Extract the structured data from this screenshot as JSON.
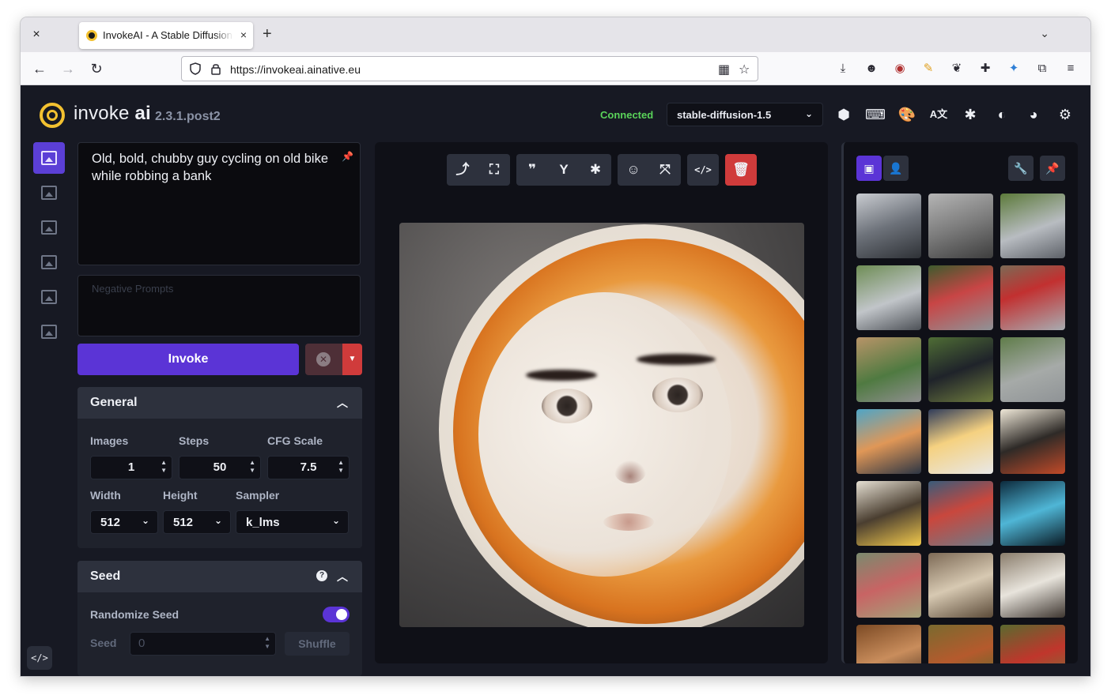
{
  "browser": {
    "tab_title": "InvokeAI - A Stable Diffusion Toolkit",
    "tab_close": "×",
    "new_tab": "+",
    "tab_list": "⌄",
    "window_close": "×",
    "url": "https://invokeai.ainative.eu"
  },
  "app": {
    "brand_light": "invoke",
    "brand_bold": "ai",
    "version": "2.3.1.post2",
    "status": "Connected",
    "model": "stable-diffusion-1.5",
    "status_color": "#5ad35a",
    "accent": "#5b34d6"
  },
  "prompt": {
    "text": "Old, bold, chubby guy cycling on old bike while robbing a bank",
    "negative_placeholder": "Negative Prompts"
  },
  "actions": {
    "invoke": "Invoke"
  },
  "general": {
    "title": "General",
    "images_label": "Images",
    "images": "1",
    "steps_label": "Steps",
    "steps": "50",
    "cfg_label": "CFG Scale",
    "cfg": "7.5",
    "width_label": "Width",
    "width": "512",
    "height_label": "Height",
    "height": "512",
    "sampler_label": "Sampler",
    "sampler": "k_lms"
  },
  "seed": {
    "title": "Seed",
    "help": "?",
    "randomize_label": "Randomize Seed",
    "randomize": true,
    "seed_label": "Seed",
    "seed_value": "0",
    "shuffle": "Shuffle"
  },
  "gallery": {
    "thumbnails": [
      "cyclist-street",
      "cyclist-grey",
      "cyclist-road",
      "cyclist-path",
      "cyclist-red-shirt",
      "cyclist-gravel",
      "cyclist-sidewalk",
      "cyclist-racer",
      "cyclist-hill",
      "comic-beer",
      "comic-dog-beer",
      "comic-cat",
      "comic-bottles",
      "city-rain",
      "digital-rain",
      "dragon",
      "wooden-bowl",
      "toilet-rolls",
      "partial-1",
      "partial-2",
      "partial-3"
    ]
  }
}
